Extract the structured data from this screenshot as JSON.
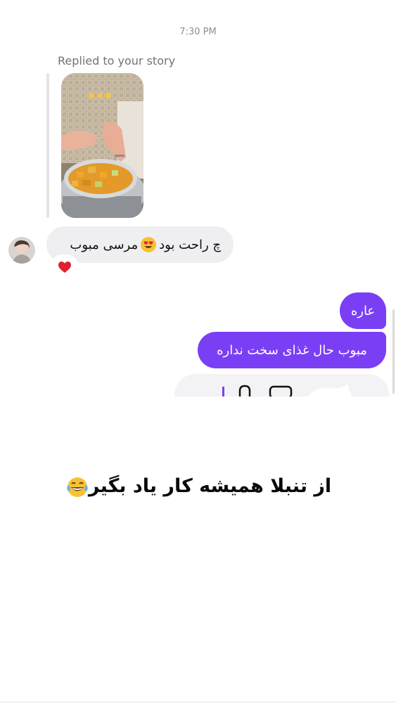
{
  "header": {
    "timestamp": "7:30 PM"
  },
  "story_reply": {
    "label": "Replied to your story"
  },
  "incoming": {
    "text": "چ راحت بود",
    "text_after": "مرسی مبوب",
    "emoji": "smiling-face-with-heart-eyes",
    "reaction": "heart"
  },
  "outgoing": [
    {
      "text": "عاره"
    },
    {
      "text": "مبوب حال غذای سخت نداره"
    }
  ],
  "caption": {
    "text": "از تنبلا همیشه کار یاد بگیر",
    "emoji": "face-with-tears-of-joy"
  },
  "colors": {
    "accent": "#7a3ff5",
    "incoming_bubble": "#efeff1",
    "reply_label": "#737373"
  }
}
